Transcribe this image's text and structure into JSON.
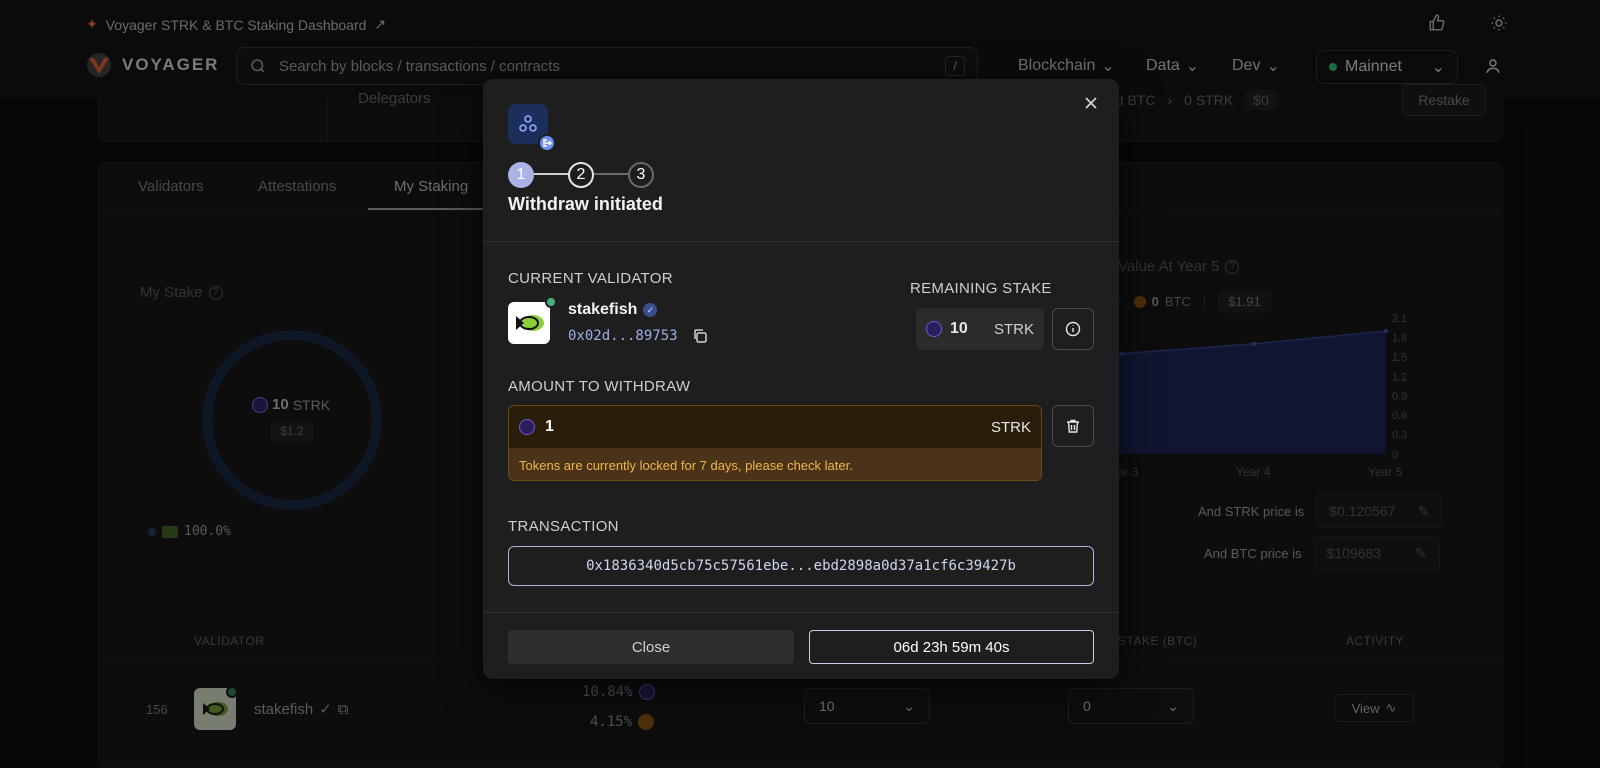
{
  "header": {
    "top_title": "Voyager STRK & BTC Staking Dashboard",
    "logo_text": "VOYAGER",
    "search_placeholder": "Search by blocks / transactions / contracts",
    "search_shortcut": "/",
    "nav": [
      "Blockchain",
      "Data",
      "Dev"
    ],
    "network": "Mainnet"
  },
  "background": {
    "delegators_label": "Delegators",
    "staked_btc_label": "ed BTC",
    "staked_btc_value": "0 STRK",
    "staked_btc_usd": "$0",
    "restake_label": "Restake",
    "tabs": [
      "Validators",
      "Attestations",
      "My Staking"
    ],
    "active_tab": "My Staking",
    "my_stake_label": "My Stake",
    "donut_value": "10",
    "donut_unit": "STRK",
    "donut_usd": "$1.2",
    "donut_legend_pct": "100.0%",
    "value_at_year_label": "Value At Year 5",
    "value_btc": "0",
    "value_btc_unit": "BTC",
    "value_usd": "$1.91",
    "strk_price_label": "And STRK price is",
    "strk_price": "$0.120567",
    "btc_price_label": "And BTC price is",
    "btc_price": "$109683",
    "table_headers": {
      "validator": "VALIDATOR",
      "stake_btc": "STAKE (BTC)",
      "activity": "ACTIVITY"
    },
    "row": {
      "rank": "156",
      "name": "stakefish",
      "pct_strk": "10.84%",
      "pct_btc": "4.15%",
      "strk_select": "10",
      "btc_select": "0",
      "view_label": "View"
    }
  },
  "chart_data": {
    "type": "area",
    "x": [
      "Year 3",
      "Year 4",
      "Year 5"
    ],
    "values": [
      1.55,
      1.7,
      1.9
    ],
    "y_ticks": [
      "2.1",
      "1.8",
      "1.5",
      "1.2",
      "0.9",
      "0.6",
      "0.3",
      "0"
    ],
    "ylim": [
      0,
      2.1
    ],
    "color": "#1a2550"
  },
  "modal": {
    "steps": [
      "1",
      "2",
      "3"
    ],
    "current_step": 2,
    "title": "Withdraw initiated",
    "current_validator_label": "CURRENT VALIDATOR",
    "validator_name": "stakefish",
    "validator_address": "0x02d...89753",
    "remaining_stake_label": "REMAINING STAKE",
    "remaining_stake_value": "10",
    "remaining_stake_unit": "STRK",
    "amount_label": "AMOUNT TO WITHDRAW",
    "amount_value": "1",
    "amount_unit": "STRK",
    "lock_warning": "Tokens are currently locked for 7 days, please check later.",
    "transaction_label": "TRANSACTION",
    "transaction_hash": "0x1836340d5cb75c57561ebe...ebd2898a0d37a1cf6c39427b",
    "close_label": "Close",
    "timer_label": "06d 23h 59m 40s"
  },
  "colors": {
    "accent": "#a9b3e6",
    "warning_text": "#f0b54a",
    "warning_bg": "#4a3318",
    "online": "#46b07a"
  }
}
